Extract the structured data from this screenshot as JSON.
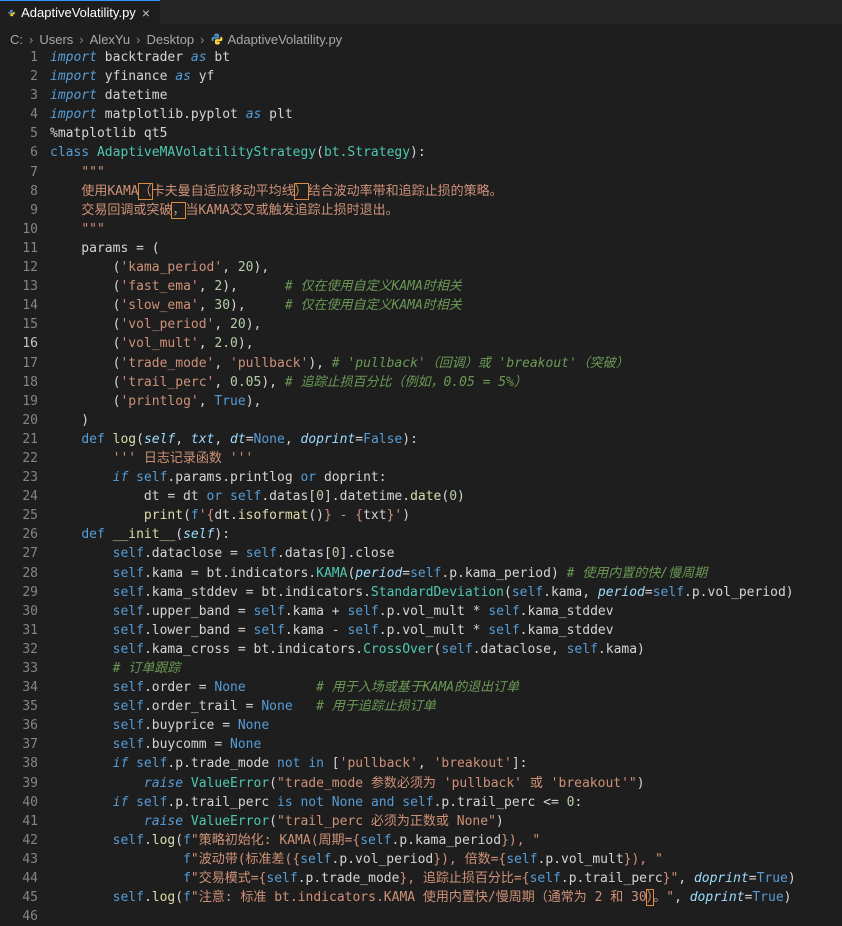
{
  "tab": {
    "filename": "AdaptiveVolatility.py",
    "close_glyph": "×"
  },
  "breadcrumb": [
    "C:",
    "Users",
    "AlexYu",
    "Desktop",
    "AdaptiveVolatility.py"
  ],
  "active_line": 16,
  "lines": [
    {
      "n": 1,
      "c": "<span class='kw'>import</span> backtrader <span class='kw'>as</span> bt"
    },
    {
      "n": 2,
      "c": "<span class='kw'>import</span> yfinance <span class='kw'>as</span> yf"
    },
    {
      "n": 3,
      "c": "<span class='kw'>import</span> datetime"
    },
    {
      "n": 4,
      "c": "<span class='kw'>import</span> matplotlib.pyplot <span class='kw'>as</span> plt"
    },
    {
      "n": 5,
      "c": "%matplotlib qt5"
    },
    {
      "n": 6,
      "c": "<span class='self'>class</span> <span class='cls'>AdaptiveMAVolatilityStrategy</span>(<span class='cls'>bt.Strategy</span>):"
    },
    {
      "n": 7,
      "c": "    <span class='str'>\"\"\"</span>"
    },
    {
      "n": 8,
      "c": "    <span class='str'>使用KAMA<span class='box'>（</span>卡夫曼自适应移动平均线<span class='box'>）</span>结合波动率带和追踪止损的策略。</span>"
    },
    {
      "n": 9,
      "c": "    <span class='str'>交易回调或突破<span class='box'>，</span>当KAMA交叉或触发追踪止损时退出。</span>"
    },
    {
      "n": 10,
      "c": "    <span class='str'>\"\"\"</span>"
    },
    {
      "n": 11,
      "c": "    params = ("
    },
    {
      "n": 12,
      "c": "        (<span class='str'>'kama_period'</span>, <span class='num'>20</span>),"
    },
    {
      "n": 13,
      "c": "        (<span class='str'>'fast_ema'</span>, <span class='num'>2</span>),      <span class='cm'># 仅在使用自定义KAMA时相关</span>"
    },
    {
      "n": 14,
      "c": "        (<span class='str'>'slow_ema'</span>, <span class='num'>30</span>),     <span class='cm'># 仅在使用自定义KAMA时相关</span>"
    },
    {
      "n": 15,
      "c": "        (<span class='str'>'vol_period'</span>, <span class='num'>20</span>),"
    },
    {
      "n": 16,
      "c": "        (<span class='str'>'vol_mult'</span>, <span class='num'>2.0</span>),"
    },
    {
      "n": 17,
      "c": "        (<span class='str'>'trade_mode'</span>, <span class='str'>'pullback'</span>), <span class='cm'># 'pullback'（回调）或 'breakout'（突破）</span>"
    },
    {
      "n": 18,
      "c": "        (<span class='str'>'trail_perc'</span>, <span class='num'>0.05</span>), <span class='cm'># 追踪止损百分比（例如，0.05 = 5%）</span>"
    },
    {
      "n": 19,
      "c": "        (<span class='str'>'printlog'</span>, <span class='self'>True</span>),"
    },
    {
      "n": 20,
      "c": "    )"
    },
    {
      "n": 21,
      "c": "    <span class='self'>def</span> <span class='fn'>log</span>(<span class='param'>self</span>, <span class='param'>txt</span>, <span class='param'>dt</span>=<span class='self'>None</span>, <span class='param'>doprint</span>=<span class='self'>False</span>):"
    },
    {
      "n": 22,
      "c": "        <span class='str'>''' 日志记录函数 '''</span>"
    },
    {
      "n": 23,
      "c": "        <span class='kw'>if</span> <span class='self'>self</span>.params.printlog <span class='self'>or</span> doprint:"
    },
    {
      "n": 24,
      "c": "            dt = dt <span class='self'>or</span> <span class='self'>self</span>.datas[<span class='num'>0</span>].datetime.<span class='fn'>date</span>(<span class='num'>0</span>)"
    },
    {
      "n": 25,
      "c": "            <span class='fn'>print</span>(<span class='self'>f</span><span class='str'>'{</span>dt.<span class='fn'>isoformat</span>()<span class='str'>} - {</span>txt<span class='str'>}'</span>)"
    },
    {
      "n": 26,
      "c": "    <span class='self'>def</span> <span class='fn'>__init__</span>(<span class='param'>self</span>):"
    },
    {
      "n": 27,
      "c": "        <span class='self'>self</span>.dataclose = <span class='self'>self</span>.datas[<span class='num'>0</span>].close"
    },
    {
      "n": 28,
      "c": "        <span class='self'>self</span>.kama = bt.indicators.<span class='cls'>KAMA</span>(<span class='param'>period</span>=<span class='self'>self</span>.p.kama_period) <span class='cm'># 使用内置的快/慢周期</span>"
    },
    {
      "n": 29,
      "c": "        <span class='self'>self</span>.kama_stddev = bt.indicators.<span class='cls'>StandardDeviation</span>(<span class='self'>self</span>.kama, <span class='param'>period</span>=<span class='self'>self</span>.p.vol_period)"
    },
    {
      "n": 30,
      "c": "        <span class='self'>self</span>.upper_band = <span class='self'>self</span>.kama + <span class='self'>self</span>.p.vol_mult * <span class='self'>self</span>.kama_stddev"
    },
    {
      "n": 31,
      "c": "        <span class='self'>self</span>.lower_band = <span class='self'>self</span>.kama - <span class='self'>self</span>.p.vol_mult * <span class='self'>self</span>.kama_stddev"
    },
    {
      "n": 32,
      "c": "        <span class='self'>self</span>.kama_cross = bt.indicators.<span class='cls'>CrossOver</span>(<span class='self'>self</span>.dataclose, <span class='self'>self</span>.kama)"
    },
    {
      "n": 33,
      "c": "        <span class='cm'># 订单跟踪</span>"
    },
    {
      "n": 34,
      "c": "        <span class='self'>self</span>.order = <span class='self'>None</span>         <span class='cm'># 用于入场或基于KAMA的退出订单</span>"
    },
    {
      "n": 35,
      "c": "        <span class='self'>self</span>.order_trail = <span class='self'>None</span>   <span class='cm'># 用于追踪止损订单</span>"
    },
    {
      "n": 36,
      "c": "        <span class='self'>self</span>.buyprice = <span class='self'>None</span>"
    },
    {
      "n": 37,
      "c": "        <span class='self'>self</span>.buycomm = <span class='self'>None</span>"
    },
    {
      "n": 38,
      "c": "        <span class='kw'>if</span> <span class='self'>self</span>.p.trade_mode <span class='self'>not</span> <span class='self'>in</span> [<span class='str'>'pullback'</span>, <span class='str'>'breakout'</span>]:"
    },
    {
      "n": 39,
      "c": "            <span class='kw'>raise</span> <span class='cls'>ValueError</span>(<span class='str'>\"trade_mode 参数必须为 'pullback' 或 'breakout'\"</span>)"
    },
    {
      "n": 40,
      "c": "        <span class='kw'>if</span> <span class='self'>self</span>.p.trail_perc <span class='self'>is</span> <span class='self'>not</span> <span class='self'>None</span> <span class='self'>and</span> <span class='self'>self</span>.p.trail_perc &lt;= <span class='num'>0</span>:"
    },
    {
      "n": 41,
      "c": "            <span class='kw'>raise</span> <span class='cls'>ValueError</span>(<span class='str'>\"trail_perc 必须为正数或 None\"</span>)"
    },
    {
      "n": 42,
      "c": "        <span class='self'>self</span>.<span class='fn'>log</span>(<span class='self'>f</span><span class='str'>\"策略初始化: KAMA(周期={</span><span class='self'>self</span>.p.kama_period<span class='str'>}), \"</span>"
    },
    {
      "n": 43,
      "c": "                 <span class='self'>f</span><span class='str'>\"波动带(标准差({</span><span class='self'>self</span>.p.vol_period<span class='str'>}), 倍数={</span><span class='self'>self</span>.p.vol_mult<span class='str'>}), \"</span>"
    },
    {
      "n": 44,
      "c": "                 <span class='self'>f</span><span class='str'>\"交易模式={</span><span class='self'>self</span>.p.trade_mode<span class='str'>}, 追踪止损百分比={</span><span class='self'>self</span>.p.trail_perc<span class='str'>}\"</span>, <span class='param'>doprint</span>=<span class='self'>True</span>)"
    },
    {
      "n": 45,
      "c": "        <span class='self'>self</span>.<span class='fn'>log</span>(<span class='self'>f</span><span class='str'>\"注意: 标准 bt.indicators.KAMA 使用内置快/慢周期（通常为 2 和 30<span class='box'>）</span>。\"</span>, <span class='param'>doprint</span>=<span class='self'>True</span>)"
    },
    {
      "n": 46,
      "c": ""
    }
  ]
}
